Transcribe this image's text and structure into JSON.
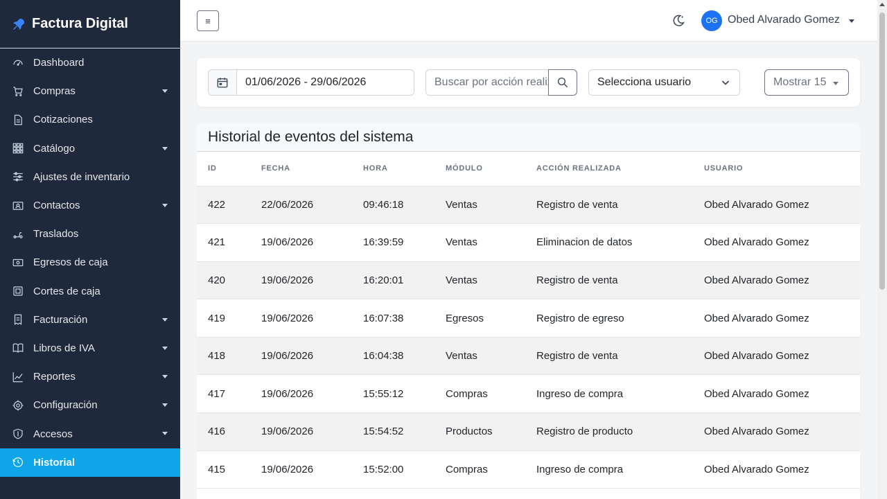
{
  "brand": {
    "title": "Factura Digital",
    "icon": "rocket-icon"
  },
  "sidebar": {
    "items": [
      {
        "label": "Dashboard",
        "icon": "dashboard-icon",
        "has_submenu": false
      },
      {
        "label": "Compras",
        "icon": "cart-icon",
        "has_submenu": true
      },
      {
        "label": "Cotizaciones",
        "icon": "document-icon",
        "has_submenu": false
      },
      {
        "label": "Catálogo",
        "icon": "grid-icon",
        "has_submenu": true
      },
      {
        "label": "Ajustes de inventario",
        "icon": "sliders-icon",
        "has_submenu": false
      },
      {
        "label": "Contactos",
        "icon": "contact-card-icon",
        "has_submenu": true
      },
      {
        "label": "Traslados",
        "icon": "scooter-icon",
        "has_submenu": false
      },
      {
        "label": "Egresos de caja",
        "icon": "cash-icon",
        "has_submenu": false
      },
      {
        "label": "Cortes de caja",
        "icon": "cash-register-icon",
        "has_submenu": false
      },
      {
        "label": "Facturación",
        "icon": "invoice-icon",
        "has_submenu": true
      },
      {
        "label": "Libros de IVA",
        "icon": "book-icon",
        "has_submenu": true
      },
      {
        "label": "Reportes",
        "icon": "chart-line-icon",
        "has_submenu": true
      },
      {
        "label": "Configuración",
        "icon": "gear-icon",
        "has_submenu": true
      },
      {
        "label": "Accesos",
        "icon": "shield-icon",
        "has_submenu": true
      },
      {
        "label": "Historial",
        "icon": "clock-icon",
        "has_submenu": false,
        "active": true
      }
    ]
  },
  "topbar": {
    "toggle_label": "≡",
    "theme_icon": "moon-icon",
    "avatar_initials": "OG",
    "user_name": "Obed Alvarado Gomez"
  },
  "filters": {
    "date_range": "01/06/2026 - 29/06/2026",
    "search_placeholder": "Buscar por acción realizada",
    "user_select": "Selecciona usuario",
    "show_label": "Mostrar 15"
  },
  "table": {
    "title": "Historial de eventos del sistema",
    "headers": [
      "ID",
      "FECHA",
      "HORA",
      "MÓDULO",
      "ACCIÓN REALIZADA",
      "USUARIO"
    ],
    "rows": [
      [
        "422",
        "22/06/2026",
        "09:46:18",
        "Ventas",
        "Registro de venta",
        "Obed Alvarado Gomez"
      ],
      [
        "421",
        "19/06/2026",
        "16:39:59",
        "Ventas",
        "Eliminacion de datos",
        "Obed Alvarado Gomez"
      ],
      [
        "420",
        "19/06/2026",
        "16:20:01",
        "Ventas",
        "Registro de venta",
        "Obed Alvarado Gomez"
      ],
      [
        "419",
        "19/06/2026",
        "16:07:38",
        "Egresos",
        "Registro de egreso",
        "Obed Alvarado Gomez"
      ],
      [
        "418",
        "19/06/2026",
        "16:04:38",
        "Ventas",
        "Registro de venta",
        "Obed Alvarado Gomez"
      ],
      [
        "417",
        "19/06/2026",
        "15:55:12",
        "Compras",
        "Ingreso de compra",
        "Obed Alvarado Gomez"
      ],
      [
        "416",
        "19/06/2026",
        "15:54:52",
        "Productos",
        "Registro de producto",
        "Obed Alvarado Gomez"
      ],
      [
        "415",
        "19/06/2026",
        "15:52:00",
        "Compras",
        "Ingreso de compra",
        "Obed Alvarado Gomez"
      ]
    ]
  },
  "colors": {
    "sidebar_bg": "#1e293b",
    "active_item": "#0ea5e9",
    "avatar_bg": "#1d72f3",
    "brand_icon": "#3b82f6"
  }
}
